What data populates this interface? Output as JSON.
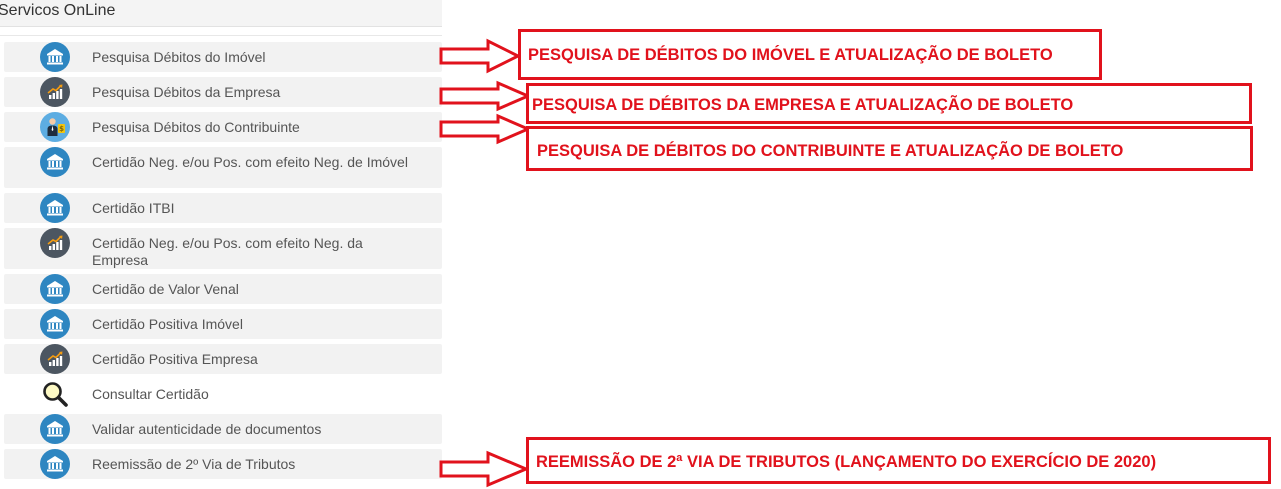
{
  "panel": {
    "title": "Servicos OnLine"
  },
  "colors": {
    "accent_red": "#e1121c",
    "icon_blue": "#2e86c1",
    "icon_slate": "#4c5661"
  },
  "menu": {
    "items": [
      {
        "label": "Pesquisa Débitos do Imóvel",
        "icon": "bank-icon"
      },
      {
        "label": "Pesquisa Débitos da Empresa",
        "icon": "chart-growth-icon"
      },
      {
        "label": "Pesquisa Débitos do Contribuinte",
        "icon": "person-money-icon"
      },
      {
        "label": "Certidão Neg. e/ou Pos. com efeito Neg. de Imóvel",
        "icon": "bank-icon"
      },
      {
        "label": "Certidão ITBI",
        "icon": "bank-icon"
      },
      {
        "label": "Certidão Neg. e/ou Pos. com efeito Neg. da Empresa",
        "icon": "chart-growth-icon"
      },
      {
        "label": "Certidão de Valor Venal",
        "icon": "bank-icon"
      },
      {
        "label": "Certidão Positiva Imóvel",
        "icon": "bank-icon"
      },
      {
        "label": "Certidão Positiva Empresa",
        "icon": "chart-growth-icon"
      },
      {
        "label": "Consultar Certidão",
        "icon": "magnifier-icon"
      },
      {
        "label": "Validar autenticidade de documentos",
        "icon": "bank-icon"
      },
      {
        "label": "Reemissão de 2º Via de Tributos",
        "icon": "bank-icon"
      }
    ]
  },
  "annotations": [
    {
      "text": "PESQUISA DE DÉBITOS DO IMÓVEL E ATUALIZAÇÃO DE BOLETO"
    },
    {
      "text": "PESQUISA DE DÉBITOS DA EMPRESA E ATUALIZAÇÃO DE BOLETO"
    },
    {
      "text": "PESQUISA DE DÉBITOS DO CONTRIBUINTE E ATUALIZAÇÃO DE BOLETO"
    },
    {
      "text": "REEMISSÃO DE 2ª VIA DE TRIBUTOS (LANÇAMENTO DO EXERCÍCIO DE 2020)"
    }
  ]
}
